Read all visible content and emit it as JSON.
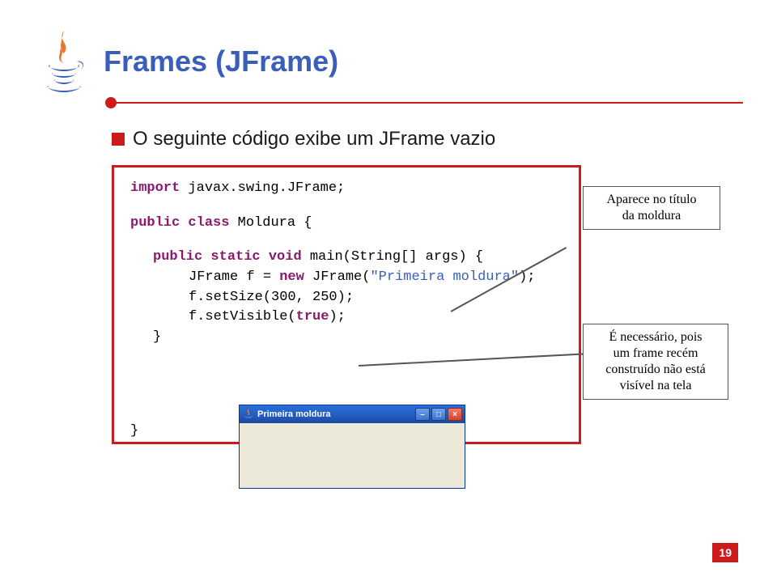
{
  "title": "Frames (JFrame)",
  "bullet_text": "O seguinte código exibe um JFrame vazio",
  "code": {
    "l1a": "import",
    "l1b": " javax.swing.JFrame;",
    "l2a": "public",
    "l2b": " class",
    "l2c": " Moldura {",
    "l3a": "public",
    "l3b": " static",
    "l3c": " void",
    "l3d": " main(String[] args) {",
    "l4a": "JFrame f = ",
    "l4b": "new",
    "l4c": " JFrame(",
    "l4d": "\"Primeira moldura\"",
    "l4e": ");",
    "l5": "f.setSize(300, 250);",
    "l6a": "f.setVisible(",
    "l6b": "true",
    "l6c": ");",
    "l7": "}",
    "l8": "}"
  },
  "callouts": {
    "c1a": "Aparece no título",
    "c1b": "da moldura",
    "c2a": "É necessário, pois",
    "c2b": "um frame recém",
    "c2c": "construído não está",
    "c2d": "visível na tela"
  },
  "mock_window_title": "Primeira moldura",
  "page_number": "19",
  "icons": {
    "bullet": "bullet-square",
    "java_logo": "java-logo",
    "win_min": "–",
    "win_max": "□",
    "win_close": "×"
  }
}
